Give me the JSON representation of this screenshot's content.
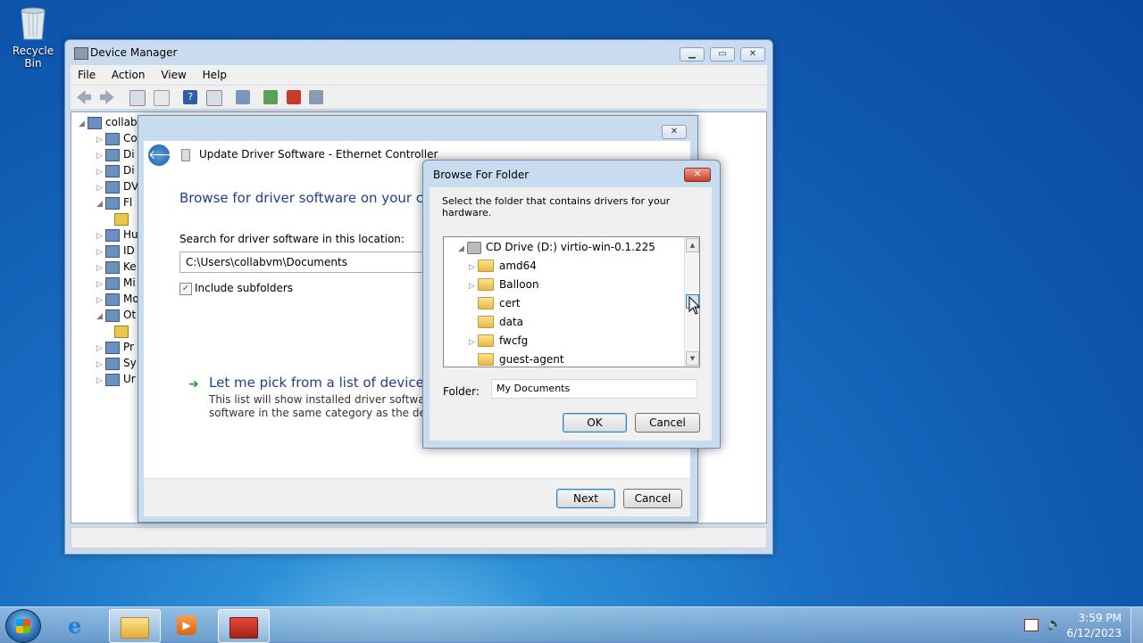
{
  "desktop": {
    "recycle_bin_label": "Recycle Bin"
  },
  "device_manager": {
    "title": "Device Manager",
    "menu": [
      "File",
      "Action",
      "View",
      "Help"
    ],
    "tree": {
      "root": "collab",
      "rows": [
        "Co",
        "Di",
        "Di",
        "DV",
        "Fl",
        "",
        "Hu",
        "ID",
        "Ke",
        "Mi",
        "Mo",
        "Ot",
        "",
        "Pr",
        "Sy",
        "Ur"
      ]
    }
  },
  "update_driver": {
    "title": "Update Driver Software - Ethernet Controller",
    "heading": "Browse for driver software on your com",
    "search_label": "Search for driver software in this location:",
    "path_value": "C:\\Users\\collabvm\\Documents",
    "include_subfolders": "Include subfolders",
    "include_subfolders_checked": true,
    "pick_title": "Let me pick from a list of device dri",
    "pick_desc_1": "This list will show installed driver software cor",
    "pick_desc_2": "software in the same category as the device.",
    "next_label": "Next",
    "cancel_label": "Cancel"
  },
  "browse_folder": {
    "title": "Browse For Folder",
    "instruction": "Select the folder that contains drivers for your hardware.",
    "drive": "CD Drive (D:) virtio-win-0.1.225",
    "folders": [
      {
        "name": "amd64",
        "expandable": true
      },
      {
        "name": "Balloon",
        "expandable": true
      },
      {
        "name": "cert",
        "expandable": false
      },
      {
        "name": "data",
        "expandable": false
      },
      {
        "name": "fwcfg",
        "expandable": true
      },
      {
        "name": "guest-agent",
        "expandable": false
      }
    ],
    "folder_label": "Folder:",
    "folder_value": "My Documents",
    "ok_label": "OK",
    "cancel_label": "Cancel"
  },
  "taskbar": {
    "time": "3:59 PM",
    "date": "6/12/2023"
  },
  "icons": {
    "start": "windows-start-icon",
    "ie": "internet-explorer-icon",
    "explorer": "file-explorer-icon",
    "media": "media-player-icon",
    "toolbox": "toolbox-icon"
  }
}
